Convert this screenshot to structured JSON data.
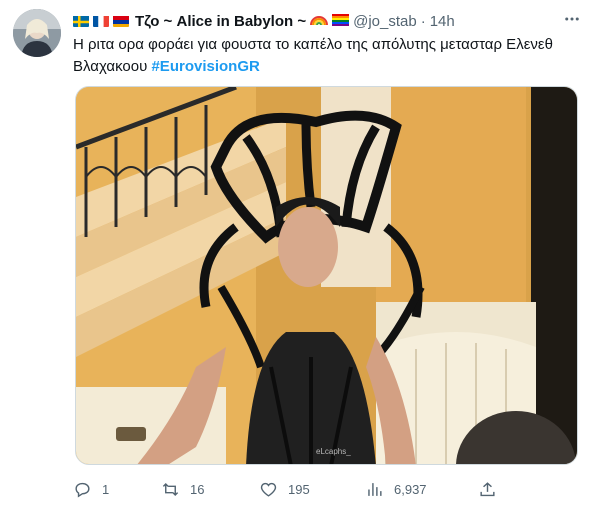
{
  "tweet": {
    "author": {
      "display_name": "Τζο ~ Alice in Babylon ~",
      "handle": "@jo_stab",
      "time": "14h",
      "separator": "·",
      "flags": [
        "sweden-flag-icon",
        "france-flag-icon",
        "armenia-flag-icon"
      ],
      "emojis": [
        "rainbow-icon",
        "rainbow-flag-icon"
      ]
    },
    "text": "Η ριτα ορα φοράει για φουστα το καπέλο της απόλυτης μετασταρ Ελενεθ Βλαχακοου",
    "hashtag": "#EurovisionGR",
    "media": {
      "watermark": "eLcaphs_"
    },
    "actions": {
      "replies": "1",
      "retweets": "16",
      "likes": "195",
      "views": "6,937"
    }
  },
  "colors": {
    "accent": "#1d9bf0",
    "secondary_text": "#536471",
    "primary_text": "#0f1419"
  }
}
